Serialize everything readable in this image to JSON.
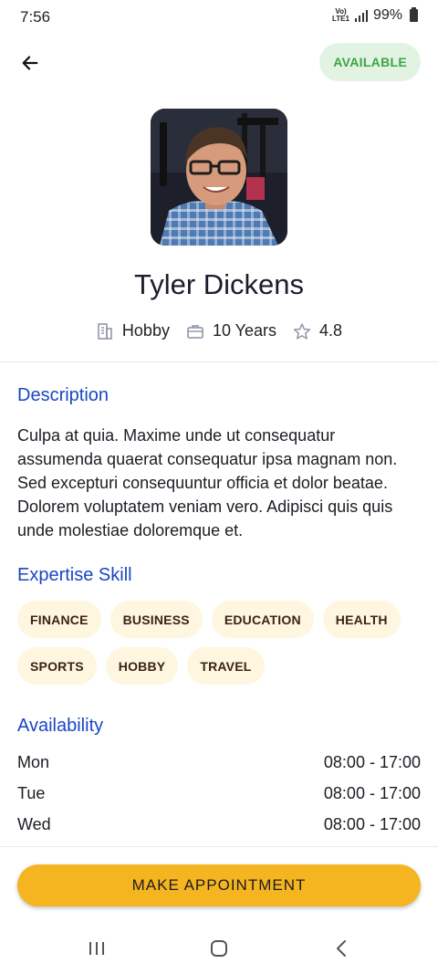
{
  "status_bar": {
    "time": "7:56",
    "network": "VoLTE LTE1",
    "battery_percent": "99%"
  },
  "header": {
    "back_icon": "arrow-left-icon",
    "status_badge": "AVAILABLE",
    "status_color": "#3aa543"
  },
  "profile": {
    "name": "Tyler Dickens",
    "category": "Hobby",
    "experience": "10 Years",
    "rating": "4.8"
  },
  "description": {
    "title": "Description",
    "text": "Culpa at quia. Maxime unde ut consequatur assumenda quaerat consequatur ipsa magnam non. Sed excepturi consequuntur officia et dolor beatae. Dolorem voluptatem veniam vero. Adipisci quis quis unde molestiae doloremque et."
  },
  "skills": {
    "title": "Expertise Skill",
    "items": [
      "FINANCE",
      "BUSINESS",
      "EDUCATION",
      "HEALTH",
      "SPORTS",
      "HOBBY",
      "TRAVEL"
    ]
  },
  "availability": {
    "title": "Availability",
    "rows": [
      {
        "day": "Mon",
        "hours": "08:00 - 17:00"
      },
      {
        "day": "Tue",
        "hours": "08:00 - 17:00"
      },
      {
        "day": "Wed",
        "hours": "08:00 - 17:00"
      }
    ]
  },
  "actions": {
    "appointment_label": "MAKE APPOINTMENT",
    "accent": "#f5b521"
  },
  "colors": {
    "section_title": "#1a46c4",
    "chip_bg": "#fef6df"
  }
}
